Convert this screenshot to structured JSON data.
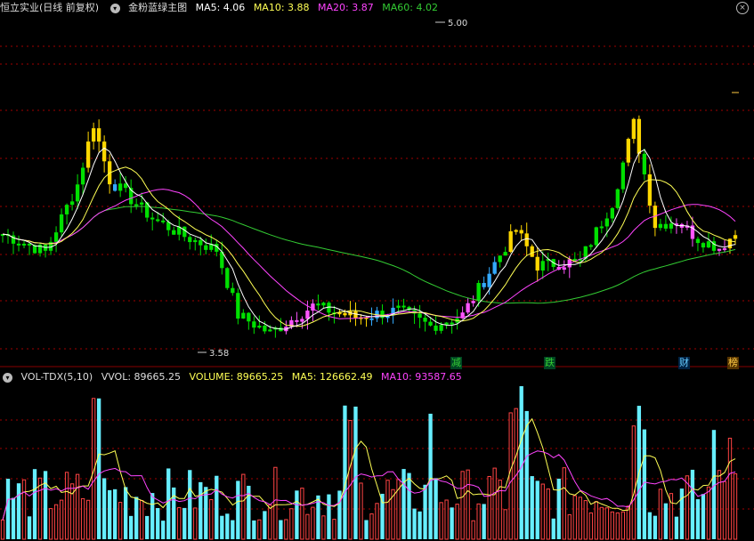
{
  "header": {
    "stock_title": "恒立实业(日线 前复权)",
    "indicator_name": "金粉蓝绿主图",
    "ma5_label": "MA5: 4.06",
    "ma10_label": "MA10: 3.88",
    "ma20_label": "MA20: 3.87",
    "ma60_label": "MA60: 4.02",
    "close_icon": "close-icon",
    "menu_icon": "chevron-down-icon"
  },
  "annotations": {
    "high_label": "5.00",
    "low_label": "3.58"
  },
  "events": {
    "e1": "减",
    "e2": "跌",
    "e3": "财",
    "e4": "榜"
  },
  "volume_header": {
    "name": "VOL-TDX(5,10)",
    "vvol_label": "VVOL: 89665.25",
    "volume_label": "VOLUME: 89665.25",
    "ma5_label": "MA5: 126662.49",
    "ma10_label": "MA10: 93587.65"
  },
  "colors": {
    "gold": "#FFD700",
    "green": "#00E000",
    "pink": "#FF55FF",
    "blue": "#33AAFF",
    "ma5": "#FFFFFF",
    "ma10": "#FFFF55",
    "ma20": "#FF44FF",
    "ma60": "#33CC33",
    "vol_red": "#FF4444",
    "vol_cyan": "#66EEFF",
    "grid": "#A00000"
  },
  "chart_data": [
    {
      "type": "candlestick",
      "price_range": [
        3.55,
        5.02
      ],
      "count": 138,
      "events": [
        "减",
        "跌",
        "财",
        "榜"
      ],
      "note_values": {
        "max": 5.0,
        "min": 3.58
      }
    },
    {
      "type": "bar",
      "series": [
        "VOLUME",
        "MA5",
        "MA10"
      ]
    }
  ]
}
